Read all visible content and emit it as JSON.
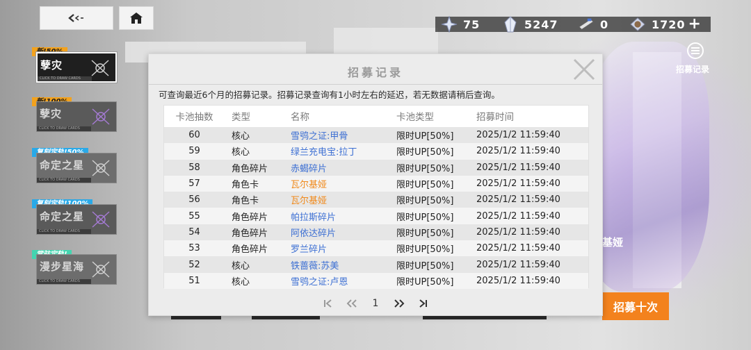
{
  "resources": [
    {
      "icon": "star-fragment-icon",
      "value": "75"
    },
    {
      "icon": "crystal-icon",
      "value": "5247"
    },
    {
      "icon": "ticket-icon",
      "value": "0"
    },
    {
      "icon": "orb-icon",
      "value": "1720"
    }
  ],
  "banners": [
    {
      "tag": "新!50%",
      "title": "孽灾",
      "tag_color": "#f3a21d",
      "active": true
    },
    {
      "tag": "新!100%",
      "title": "孽灾",
      "tag_color": "#f3a21d",
      "active": false
    },
    {
      "tag": "复刻定轨!50%",
      "title": "命定之星",
      "tag_color": "#29a9e8",
      "active": false
    },
    {
      "tag": "复刻定轨!100%",
      "title": "命定之星",
      "tag_color": "#29a9e8",
      "active": false
    },
    {
      "tag": "常驻定轨!",
      "title": "漫步星海",
      "tag_color": "#43d5b0",
      "active": false
    }
  ],
  "banner_sub": "CLICK TO DRAW CARDS",
  "side": {
    "record_label": "招募记录",
    "name_fragment": "基娅",
    "pull10_label": "招募十次"
  },
  "modal": {
    "title": "招募记录",
    "notice": "可查询最近6个月的招募记录。招募记录查询有1小时左右的延迟，若无数据请稍后查询。",
    "columns": [
      "卡池抽数",
      "类型",
      "名称",
      "卡池类型",
      "招募时间"
    ],
    "rows": [
      {
        "count": "60",
        "type": "核心",
        "name": "雪鸮之证:甲骨",
        "rarity": "blue",
        "pool": "限时UP[50%]",
        "time": "2025/1/2 11:59:40"
      },
      {
        "count": "59",
        "type": "核心",
        "name": "绿兰充电宝:拉丁",
        "rarity": "blue",
        "pool": "限时UP[50%]",
        "time": "2025/1/2 11:59:40"
      },
      {
        "count": "58",
        "type": "角色碎片",
        "name": "赤蝎碎片",
        "rarity": "blue",
        "pool": "限时UP[50%]",
        "time": "2025/1/2 11:59:40"
      },
      {
        "count": "57",
        "type": "角色卡",
        "name": "瓦尔基娅",
        "rarity": "orange",
        "pool": "限时UP[50%]",
        "time": "2025/1/2 11:59:40"
      },
      {
        "count": "56",
        "type": "角色卡",
        "name": "瓦尔基娅",
        "rarity": "orange",
        "pool": "限时UP[50%]",
        "time": "2025/1/2 11:59:40"
      },
      {
        "count": "55",
        "type": "角色碎片",
        "name": "帕拉斯碎片",
        "rarity": "blue",
        "pool": "限时UP[50%]",
        "time": "2025/1/2 11:59:40"
      },
      {
        "count": "54",
        "type": "角色碎片",
        "name": "阿依达碎片",
        "rarity": "blue",
        "pool": "限时UP[50%]",
        "time": "2025/1/2 11:59:40"
      },
      {
        "count": "53",
        "type": "角色碎片",
        "name": "罗兰碎片",
        "rarity": "blue",
        "pool": "限时UP[50%]",
        "time": "2025/1/2 11:59:40"
      },
      {
        "count": "52",
        "type": "核心",
        "name": "铁蔷薇:苏美",
        "rarity": "blue",
        "pool": "限时UP[50%]",
        "time": "2025/1/2 11:59:40"
      },
      {
        "count": "51",
        "type": "核心",
        "name": "雪鸮之证:卢恩",
        "rarity": "blue",
        "pool": "限时UP[50%]",
        "time": "2025/1/2 11:59:40"
      }
    ],
    "pager": {
      "current_page": "1"
    }
  },
  "colors": {
    "rarity_blue": "#3c6fd3",
    "rarity_orange": "#f08a1c",
    "accent": "#f3821d"
  }
}
